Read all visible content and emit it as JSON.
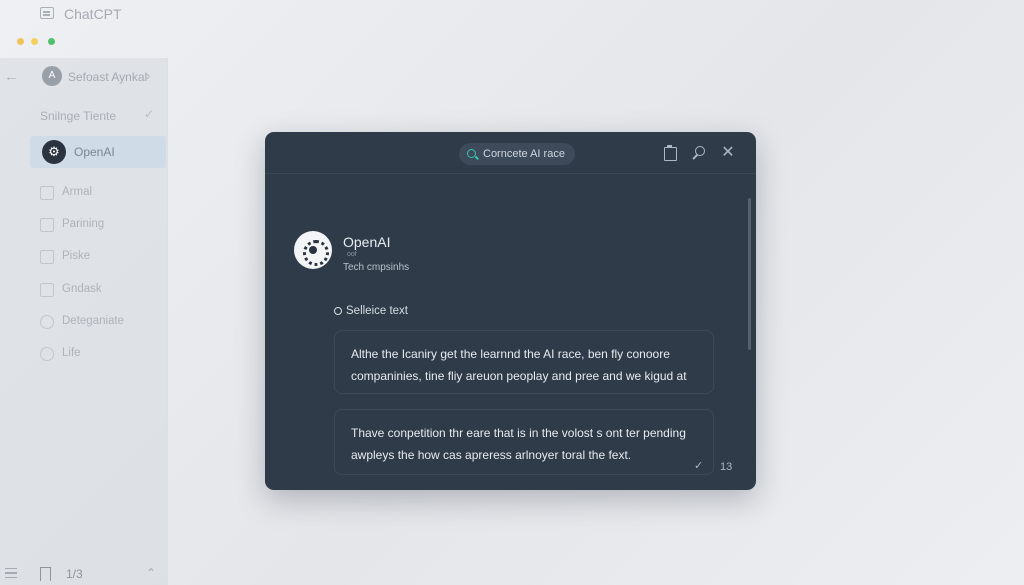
{
  "app": {
    "title": "ChatCPT"
  },
  "sidebar": {
    "workspace": {
      "avatar": "A",
      "name": "Sefoast Aynkal"
    },
    "section_label": "Snilnge Tiente",
    "active_item": {
      "logo": "⚙",
      "label": "OpenAI"
    },
    "items": [
      {
        "label": "Armal"
      },
      {
        "label": "Parining"
      },
      {
        "label": "Piske"
      },
      {
        "label": "Gndask"
      },
      {
        "label": "Deteganiate"
      },
      {
        "label": "Life"
      }
    ],
    "footer": {
      "page_counter": "1/3"
    }
  },
  "dialog": {
    "search_chip": "Corncete AI race",
    "brand": {
      "name": "OpenAI",
      "sub": "oof",
      "description": "Tech cmpsinhs"
    },
    "selection_label": "Selleice text",
    "cards": [
      {
        "text": "Althe the Icaniry get the learnnd the AI race, ben fly conoore companinies, tine fliy areuon peoplay and pree and we kigud at"
      },
      {
        "text": "Thave conpetition thr eare that is in the volost s ont ter pending awpleys the how cas apreress arlnoyer toral the fext."
      }
    ],
    "count": "13"
  }
}
